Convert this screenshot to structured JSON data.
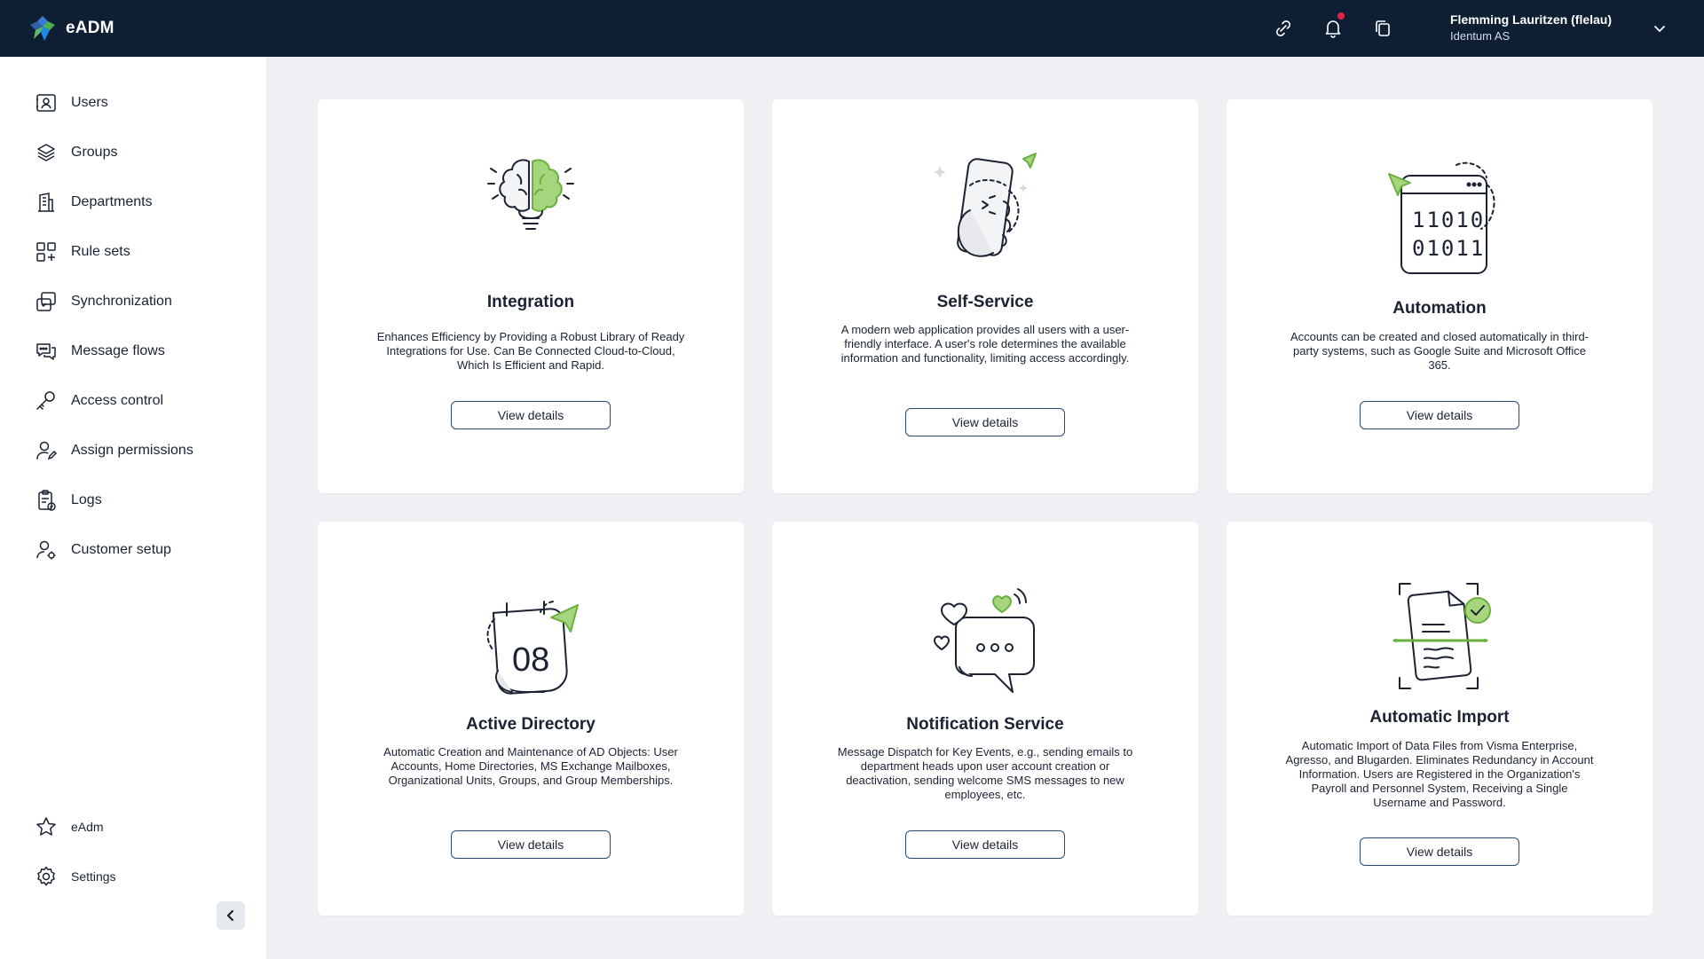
{
  "app": {
    "name": "eADM"
  },
  "header": {
    "user_name": "Flemming Lauritzen (flelau)",
    "user_org": "Identum AS",
    "notification_dot_color": "#e0234b"
  },
  "sidebar": {
    "items": [
      {
        "label": "Users",
        "icon": "user-card-icon"
      },
      {
        "label": "Groups",
        "icon": "layers-icon"
      },
      {
        "label": "Departments",
        "icon": "building-icon"
      },
      {
        "label": "Rule sets",
        "icon": "grid-icon"
      },
      {
        "label": "Synchronization",
        "icon": "sync-icon"
      },
      {
        "label": "Message flows",
        "icon": "chat-icon"
      },
      {
        "label": "Access control",
        "icon": "key-icon"
      },
      {
        "label": "Assign permissions",
        "icon": "user-edit-icon"
      },
      {
        "label": "Logs",
        "icon": "clipboard-icon"
      },
      {
        "label": "Customer setup",
        "icon": "user-gear-icon"
      }
    ],
    "bottom_items": [
      {
        "label": "eAdm",
        "icon": "star-icon"
      },
      {
        "label": "Settings",
        "icon": "gear-icon"
      }
    ]
  },
  "cards": [
    {
      "title": "Integration",
      "description": "Enhances Efficiency by Providing a Robust Library of Ready Integrations for Use. Can Be Connected Cloud-to-Cloud, Which Is Efficient and Rapid.",
      "button": "View details",
      "illustration": "brain-bulb-icon"
    },
    {
      "title": "Self-Service",
      "description": "A modern web application provides all users with a user-friendly interface. A user's role determines the available information and functionality, limiting access accordingly.",
      "button": "View details",
      "illustration": "phone-hand-icon"
    },
    {
      "title": "Automation",
      "description": "Accounts can be created and closed automatically in third-party systems, such as Google Suite and Microsoft Office 365.",
      "button": "View details",
      "illustration": "binary-window-icon"
    },
    {
      "title": "Active Directory",
      "description": "Automatic Creation and Maintenance of AD Objects: User Accounts, Home Directories, MS Exchange Mailboxes, Organizational Units, Groups, and Group Memberships.",
      "button": "View details",
      "illustration": "calendar-icon"
    },
    {
      "title": "Notification Service",
      "description": "Message Dispatch for Key Events, e.g., sending emails to department heads upon user account creation or deactivation, sending welcome SMS messages to new employees, etc.",
      "button": "View details",
      "illustration": "chat-bubble-icon"
    },
    {
      "title": "Automatic Import",
      "description": "Automatic Import of Data Files from Visma Enterprise, Agresso, and Blugarden. Eliminates Redundancy in Account Information. Users are Registered in the Organization's Payroll and Personnel System, Receiving a Single Username and Password.",
      "button": "View details",
      "illustration": "document-scan-icon"
    }
  ],
  "colors": {
    "header_bg": "#0f1f33",
    "accent_green": "#8bc34a",
    "button_border": "#2b4a73",
    "page_bg": "#eef0f3"
  }
}
